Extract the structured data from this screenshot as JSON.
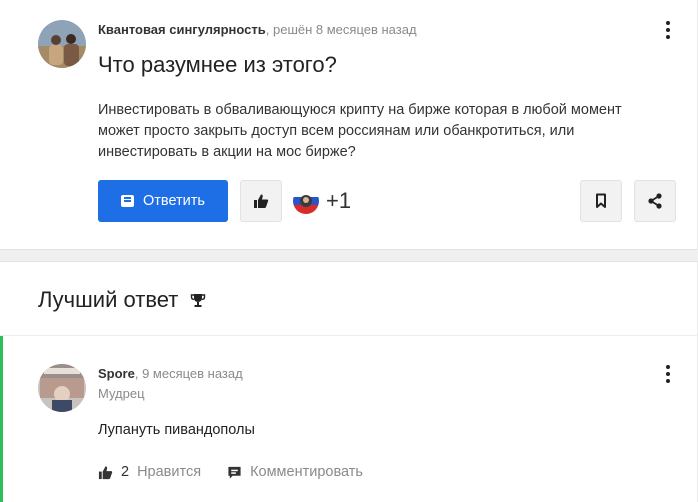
{
  "question": {
    "author": "Квантовая сингулярность",
    "meta": ", решён 8 месяцев назад",
    "title": "Что разумнее из этого?",
    "body": "Инвестировать в обваливающуюся крипту на бирже которая в любой момент может просто закрыть доступ всем россиянам или обанкротиться, или инвестировать в акции на мос бирже?",
    "answer_button_label": "Ответить",
    "votes_label": "+1"
  },
  "best_answer": {
    "heading": "Лучший ответ",
    "author": "Spore",
    "meta": ", 9 месяцев назад",
    "rank": "Мудрец",
    "text": "Лупануть пивандополы",
    "like_count": "2",
    "like_label": "Нравится",
    "comment_label": "Комментировать"
  },
  "icons": {
    "kebab": "more-vertical-icon",
    "answer": "chat-icon",
    "like": "thumbs-up-icon",
    "bookmark": "bookmark-icon",
    "share": "share-icon",
    "best": "trophy-icon",
    "comment": "comment-icon"
  },
  "colors": {
    "accent": "#1e6fe6",
    "best_answer_marker": "#2ebf5c",
    "muted_text": "#8a8a8a"
  }
}
